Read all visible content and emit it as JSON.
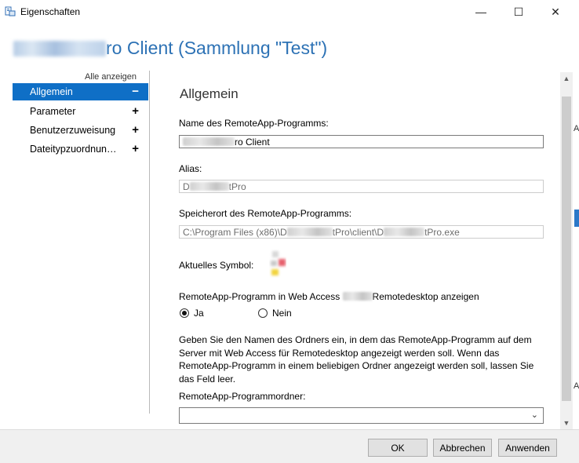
{
  "window": {
    "title": "Eigenschaften",
    "controls": {
      "minimize": "—",
      "maximize": "☐",
      "close": "✕"
    }
  },
  "heading": {
    "visible_suffix": "ro Client (Sammlung \"Test\")"
  },
  "nav": {
    "show_all": "Alle anzeigen",
    "items": [
      {
        "label": "Allgemein",
        "sign": "−",
        "selected": true
      },
      {
        "label": "Parameter",
        "sign": "+"
      },
      {
        "label": "Benutzerzuweisung",
        "sign": "+"
      },
      {
        "label": "Dateitypzuordnun…",
        "sign": "+"
      }
    ]
  },
  "general": {
    "section_title": "Allgemein",
    "program_name_label": "Name des RemoteApp-Programms:",
    "program_name_value": "ro Client",
    "alias_label": "Alias:",
    "alias_prefix": "D",
    "alias_suffix": "tPro",
    "location_label": "Speicherort des RemoteApp-Programms:",
    "location_part1": "C:\\Program Files (x86)\\D",
    "location_part2": "tPro\\client\\D",
    "location_part3": "tPro.exe",
    "symbol_label": "Aktuelles Symbol:",
    "web_access_label_start": "RemoteApp-Programm in Web Access ",
    "web_access_label_end": "Remotedesktop anzeigen",
    "radio_yes": "Ja",
    "radio_no": "Nein",
    "radio_selected": "Ja",
    "description": "Geben Sie den Namen des Ordners ein, in dem das RemoteApp-Programm auf dem Server mit Web Access für Remotedesktop angezeigt werden soll. Wenn das RemoteApp-Programm in einem beliebigen Ordner angezeigt werden soll, lassen Sie das Feld leer.",
    "folder_label": "RemoteApp-Programmordner:",
    "folder_value": ""
  },
  "scrollbar": {
    "up": "▲",
    "down": "▼",
    "chevron": "⌄"
  },
  "background_window": {
    "marks": [
      "A",
      "A"
    ]
  },
  "buttons": {
    "ok": "OK",
    "cancel": "Abbrechen",
    "apply": "Anwenden"
  },
  "colors": {
    "accent": "#0f6fc6",
    "heading": "#2d72b5"
  }
}
